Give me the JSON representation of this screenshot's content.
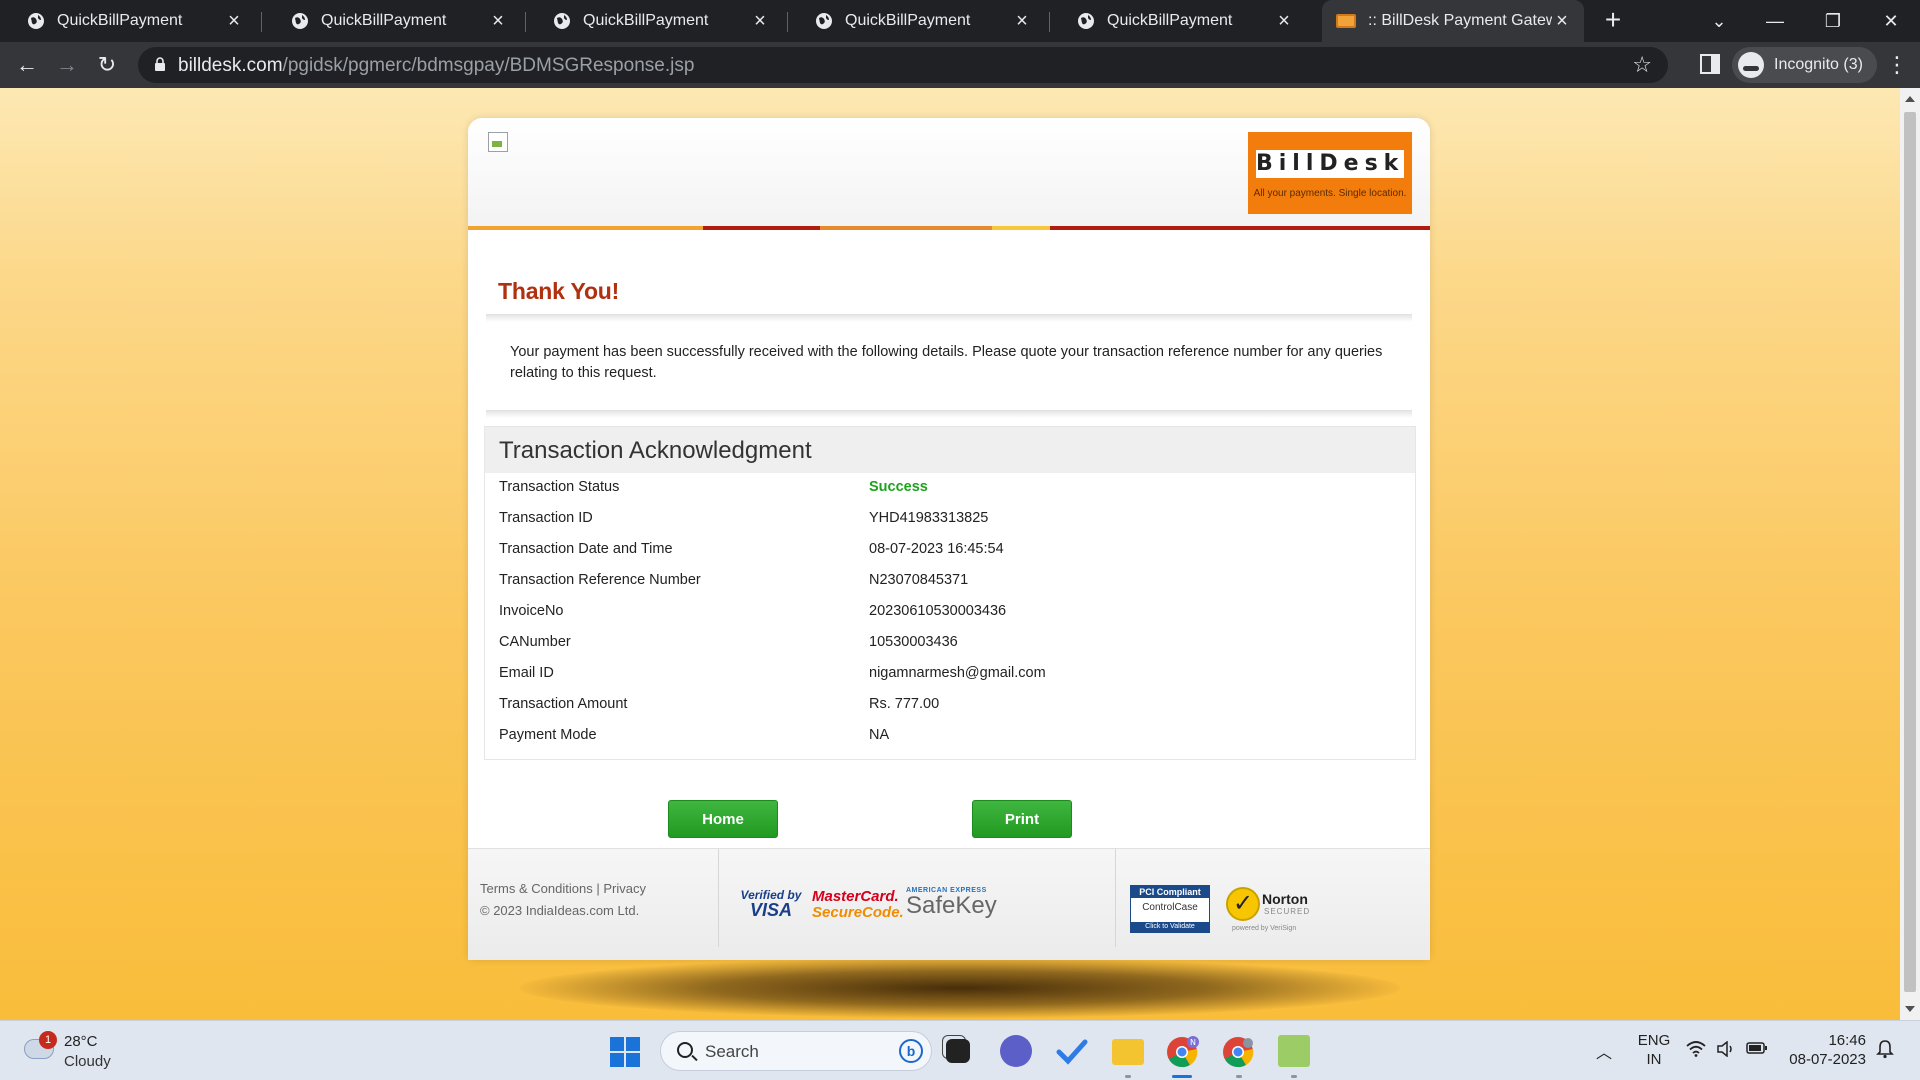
{
  "browser": {
    "tabs": [
      {
        "title": "QuickBillPayment",
        "active": false
      },
      {
        "title": "QuickBillPayment",
        "active": false
      },
      {
        "title": "QuickBillPayment",
        "active": false
      },
      {
        "title": "QuickBillPayment",
        "active": false
      },
      {
        "title": "QuickBillPayment",
        "active": false
      },
      {
        "title": ":: BillDesk Payment Gateway ::",
        "active": true
      }
    ],
    "url_domain": "billdesk.com",
    "url_path": "/pgidsk/pgmerc/bdmsgpay/BDMSGResponse.jsp",
    "incognito_label": "Incognito (3)"
  },
  "page": {
    "logo_name": "BillDesk",
    "logo_tagline": "All your payments. Single location.",
    "thank_you": "Thank You!",
    "message": "Your payment has been successfully received with the following details. Please quote your transaction reference number for any queries relating to this request.",
    "ack_title": "Transaction Acknowledgment",
    "details": [
      {
        "label": "Transaction Status",
        "value": "Success"
      },
      {
        "label": "Transaction ID",
        "value": "YHD41983313825"
      },
      {
        "label": "Transaction Date and Time",
        "value": "08-07-2023 16:45:54"
      },
      {
        "label": "Transaction Reference Number",
        "value": "N23070845371"
      },
      {
        "label": "InvoiceNo",
        "value": "20230610530003436"
      },
      {
        "label": "CANumber",
        "value": "10530003436"
      },
      {
        "label": "Email ID",
        "value": "nigamnarmesh@gmail.com"
      },
      {
        "label": "Transaction Amount",
        "value": "Rs. 777.00"
      },
      {
        "label": "Payment Mode",
        "value": "NA"
      }
    ],
    "buttons": {
      "home": "Home",
      "print": "Print"
    },
    "footer": {
      "terms": "Terms & Conditions",
      "separator": "|",
      "privacy": "Privacy",
      "copyright": "© 2023 IndiaIdeas.com Ltd.",
      "visa_top": "Verified by",
      "visa_bottom": "VISA",
      "mc_top": "MasterCard.",
      "mc_bottom": "SecureCode.",
      "amex_top": "AMERICAN EXPRESS",
      "amex_bottom": "SafeKey",
      "pci_top": "PCI Compliant",
      "pci_mid": "ControlCase",
      "pci_bot": "Click to Validate",
      "norton_name": "Norton",
      "norton_sub": "SECURED",
      "norton_by": "powered by VeriSign"
    },
    "colors": {
      "accent": "#b03010",
      "success": "#1fa31f",
      "button": "#2aa52a",
      "logo": "#f37d0c"
    }
  },
  "taskbar": {
    "weather_temp": "28°C",
    "weather_cond": "Cloudy",
    "weather_badge": "1",
    "search_label": "Search",
    "lang_top": "ENG",
    "lang_bottom": "IN",
    "time": "16:46",
    "date": "08-07-2023"
  }
}
